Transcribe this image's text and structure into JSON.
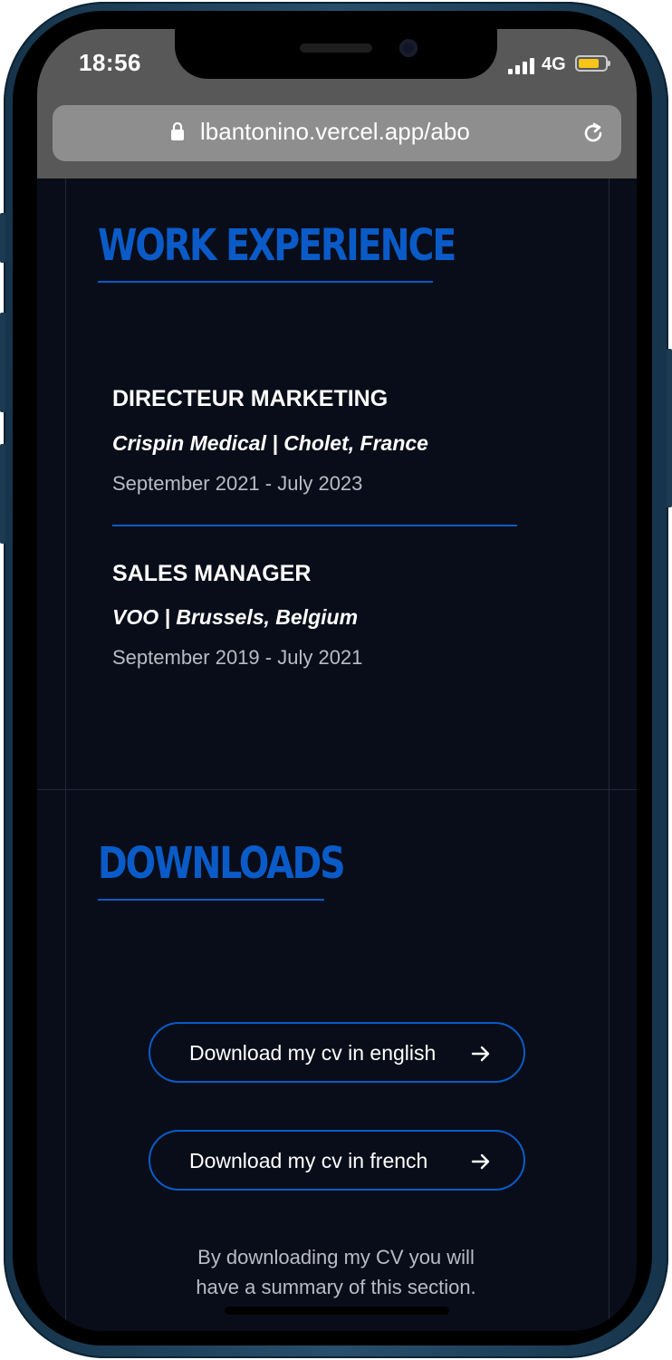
{
  "status_bar": {
    "time": "18:56",
    "network": "4G",
    "battery_color": "#f5c518"
  },
  "browser": {
    "url": "lbantonino.vercel.app/abo",
    "lock_icon": "lock-icon",
    "reload_icon": "reload-icon"
  },
  "work_experience": {
    "heading": "WORK EXPERIENCE",
    "jobs": [
      {
        "title": "DIRECTEUR MARKETING",
        "company": "Crispin Medical | Cholet, France",
        "dates": "September 2021 - July 2023"
      },
      {
        "title": "SALES MANAGER",
        "company": "VOO | Brussels, Belgium",
        "dates": "September 2019 - July 2021"
      }
    ]
  },
  "downloads": {
    "heading": "DOWNLOADS",
    "buttons": [
      {
        "label": "Download my cv in english",
        "icon": "arrow-right-icon"
      },
      {
        "label": "Download my cv in french",
        "icon": "arrow-right-icon"
      }
    ],
    "note_lines": [
      "By downloading my CV you will",
      "have a summary of this section."
    ]
  },
  "colors": {
    "accent": "#0a5bc7",
    "background": "#090d19",
    "text": "#ffffff",
    "muted": "#b9bcc4"
  }
}
